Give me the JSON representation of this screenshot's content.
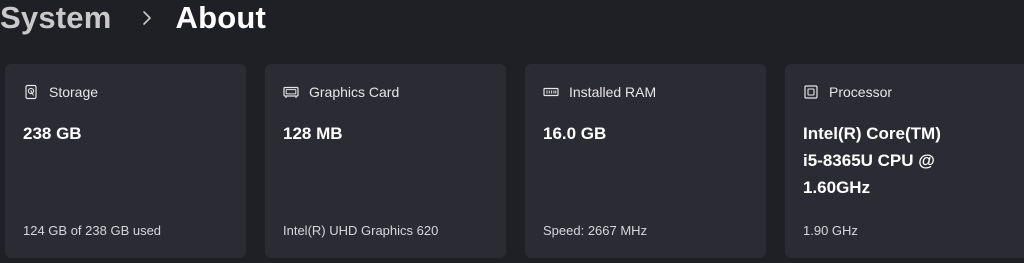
{
  "breadcrumb": {
    "parent": "System",
    "separator_icon": "chevron-right-icon",
    "current": "About"
  },
  "colors": {
    "background": "#1f1f26",
    "card_background": "#2b2b33",
    "text_primary": "#ffffff",
    "text_secondary": "#d6d6da"
  },
  "cards": [
    {
      "icon": "storage-drive-icon",
      "title": "Storage",
      "value": "238 GB",
      "detail": "124 GB of 238 GB used"
    },
    {
      "icon": "graphics-card-icon",
      "title": "Graphics Card",
      "value": "128 MB",
      "detail": "Intel(R) UHD Graphics 620"
    },
    {
      "icon": "ram-module-icon",
      "title": "Installed RAM",
      "value": "16.0 GB",
      "detail": "Speed: 2667 MHz"
    },
    {
      "icon": "processor-chip-icon",
      "title": "Processor",
      "value": "Intel(R) Core(TM)\ni5-8365U CPU @\n1.60GHz",
      "detail": "1.90 GHz"
    }
  ]
}
